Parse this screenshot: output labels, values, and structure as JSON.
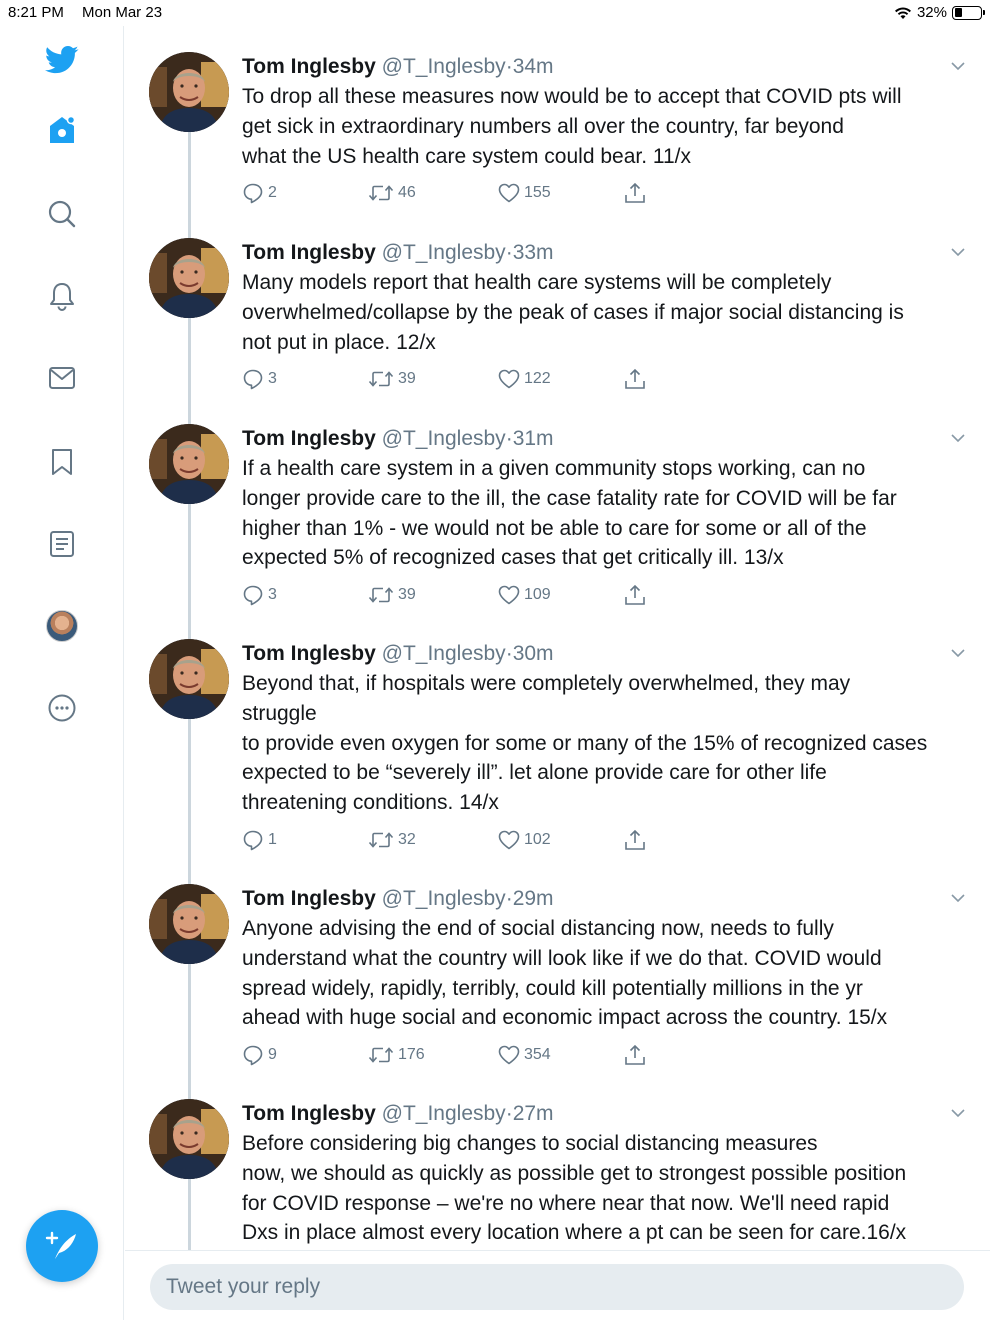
{
  "status_bar": {
    "time": "8:21 PM",
    "date": "Mon Mar 23",
    "battery_text": "32%",
    "battery_level": 0.32,
    "wifi_icon": "wifi-icon"
  },
  "sidebar": {
    "icons": [
      "twitter-logo-icon",
      "home-icon",
      "search-icon",
      "bell-icon",
      "mail-icon",
      "bookmark-icon",
      "lists-icon",
      "profile-avatar",
      "more-icon"
    ],
    "compose_icon": "compose-tweet-icon"
  },
  "colors": {
    "accent": "#1da1f2",
    "text": "#14171a",
    "secondary": "#657786",
    "border": "#e6ecf0"
  },
  "tweets": [
    {
      "name": "Tom Inglesby",
      "handle": "@T_Inglesby",
      "dot": "·",
      "time": "34m",
      "text": "To drop all these measures now would be to accept that COVID pts will\nget sick in extraordinary numbers all over the country, far beyond\nwhat the US health care system could bear.  11/x",
      "replies": "2",
      "retweets": "46",
      "likes": "155"
    },
    {
      "name": "Tom Inglesby",
      "handle": "@T_Inglesby",
      "dot": "·",
      "time": "33m",
      "text": "Many models report that health care systems will be completely\noverwhelmed/collapse by the peak of cases if major social distancing is\nnot put in place. 12/x",
      "replies": "3",
      "retweets": "39",
      "likes": "122"
    },
    {
      "name": "Tom Inglesby",
      "handle": "@T_Inglesby",
      "dot": "·",
      "time": "31m",
      "text": "If a health care system in a given community stops working, can no\nlonger provide care to the ill, the case fatality rate for COVID will be far\nhigher than 1% - we would not be able to care for some or all of the\nexpected 5% of recognized cases that get critically ill. 13/x",
      "replies": "3",
      "retweets": "39",
      "likes": "109"
    },
    {
      "name": "Tom Inglesby",
      "handle": "@T_Inglesby",
      "dot": "·",
      "time": "30m",
      "text": "Beyond that, if hospitals were completely overwhelmed, they may\nstruggle\nto provide even oxygen for some or many of the 15% of recognized cases\nexpected to be “severely ill”.  let alone provide care for other life\nthreatening conditions. 14/x",
      "replies": "1",
      "retweets": "32",
      "likes": "102"
    },
    {
      "name": "Tom Inglesby",
      "handle": "@T_Inglesby",
      "dot": "·",
      "time": "29m",
      "text": "Anyone advising the end of social distancing now, needs to fully\nunderstand what the country will look like if we do that. COVID would\nspread widely, rapidly, terribly, could kill potentially millions in the yr\nahead with huge social and economic impact across the country. 15/x",
      "replies": "9",
      "retweets": "176",
      "likes": "354"
    },
    {
      "name": "Tom Inglesby",
      "handle": "@T_Inglesby",
      "dot": "·",
      "time": "27m",
      "text": "Before considering big changes to social distancing measures\nnow, we should as quickly as possible get to strongest possible position\nfor COVID response – we're no where near that now.  We'll need rapid\nDxs in place almost every location where a pt can be seen for care.16/x",
      "replies": "",
      "retweets": "",
      "likes": ""
    }
  ],
  "reply": {
    "placeholder": "Tweet your reply"
  }
}
